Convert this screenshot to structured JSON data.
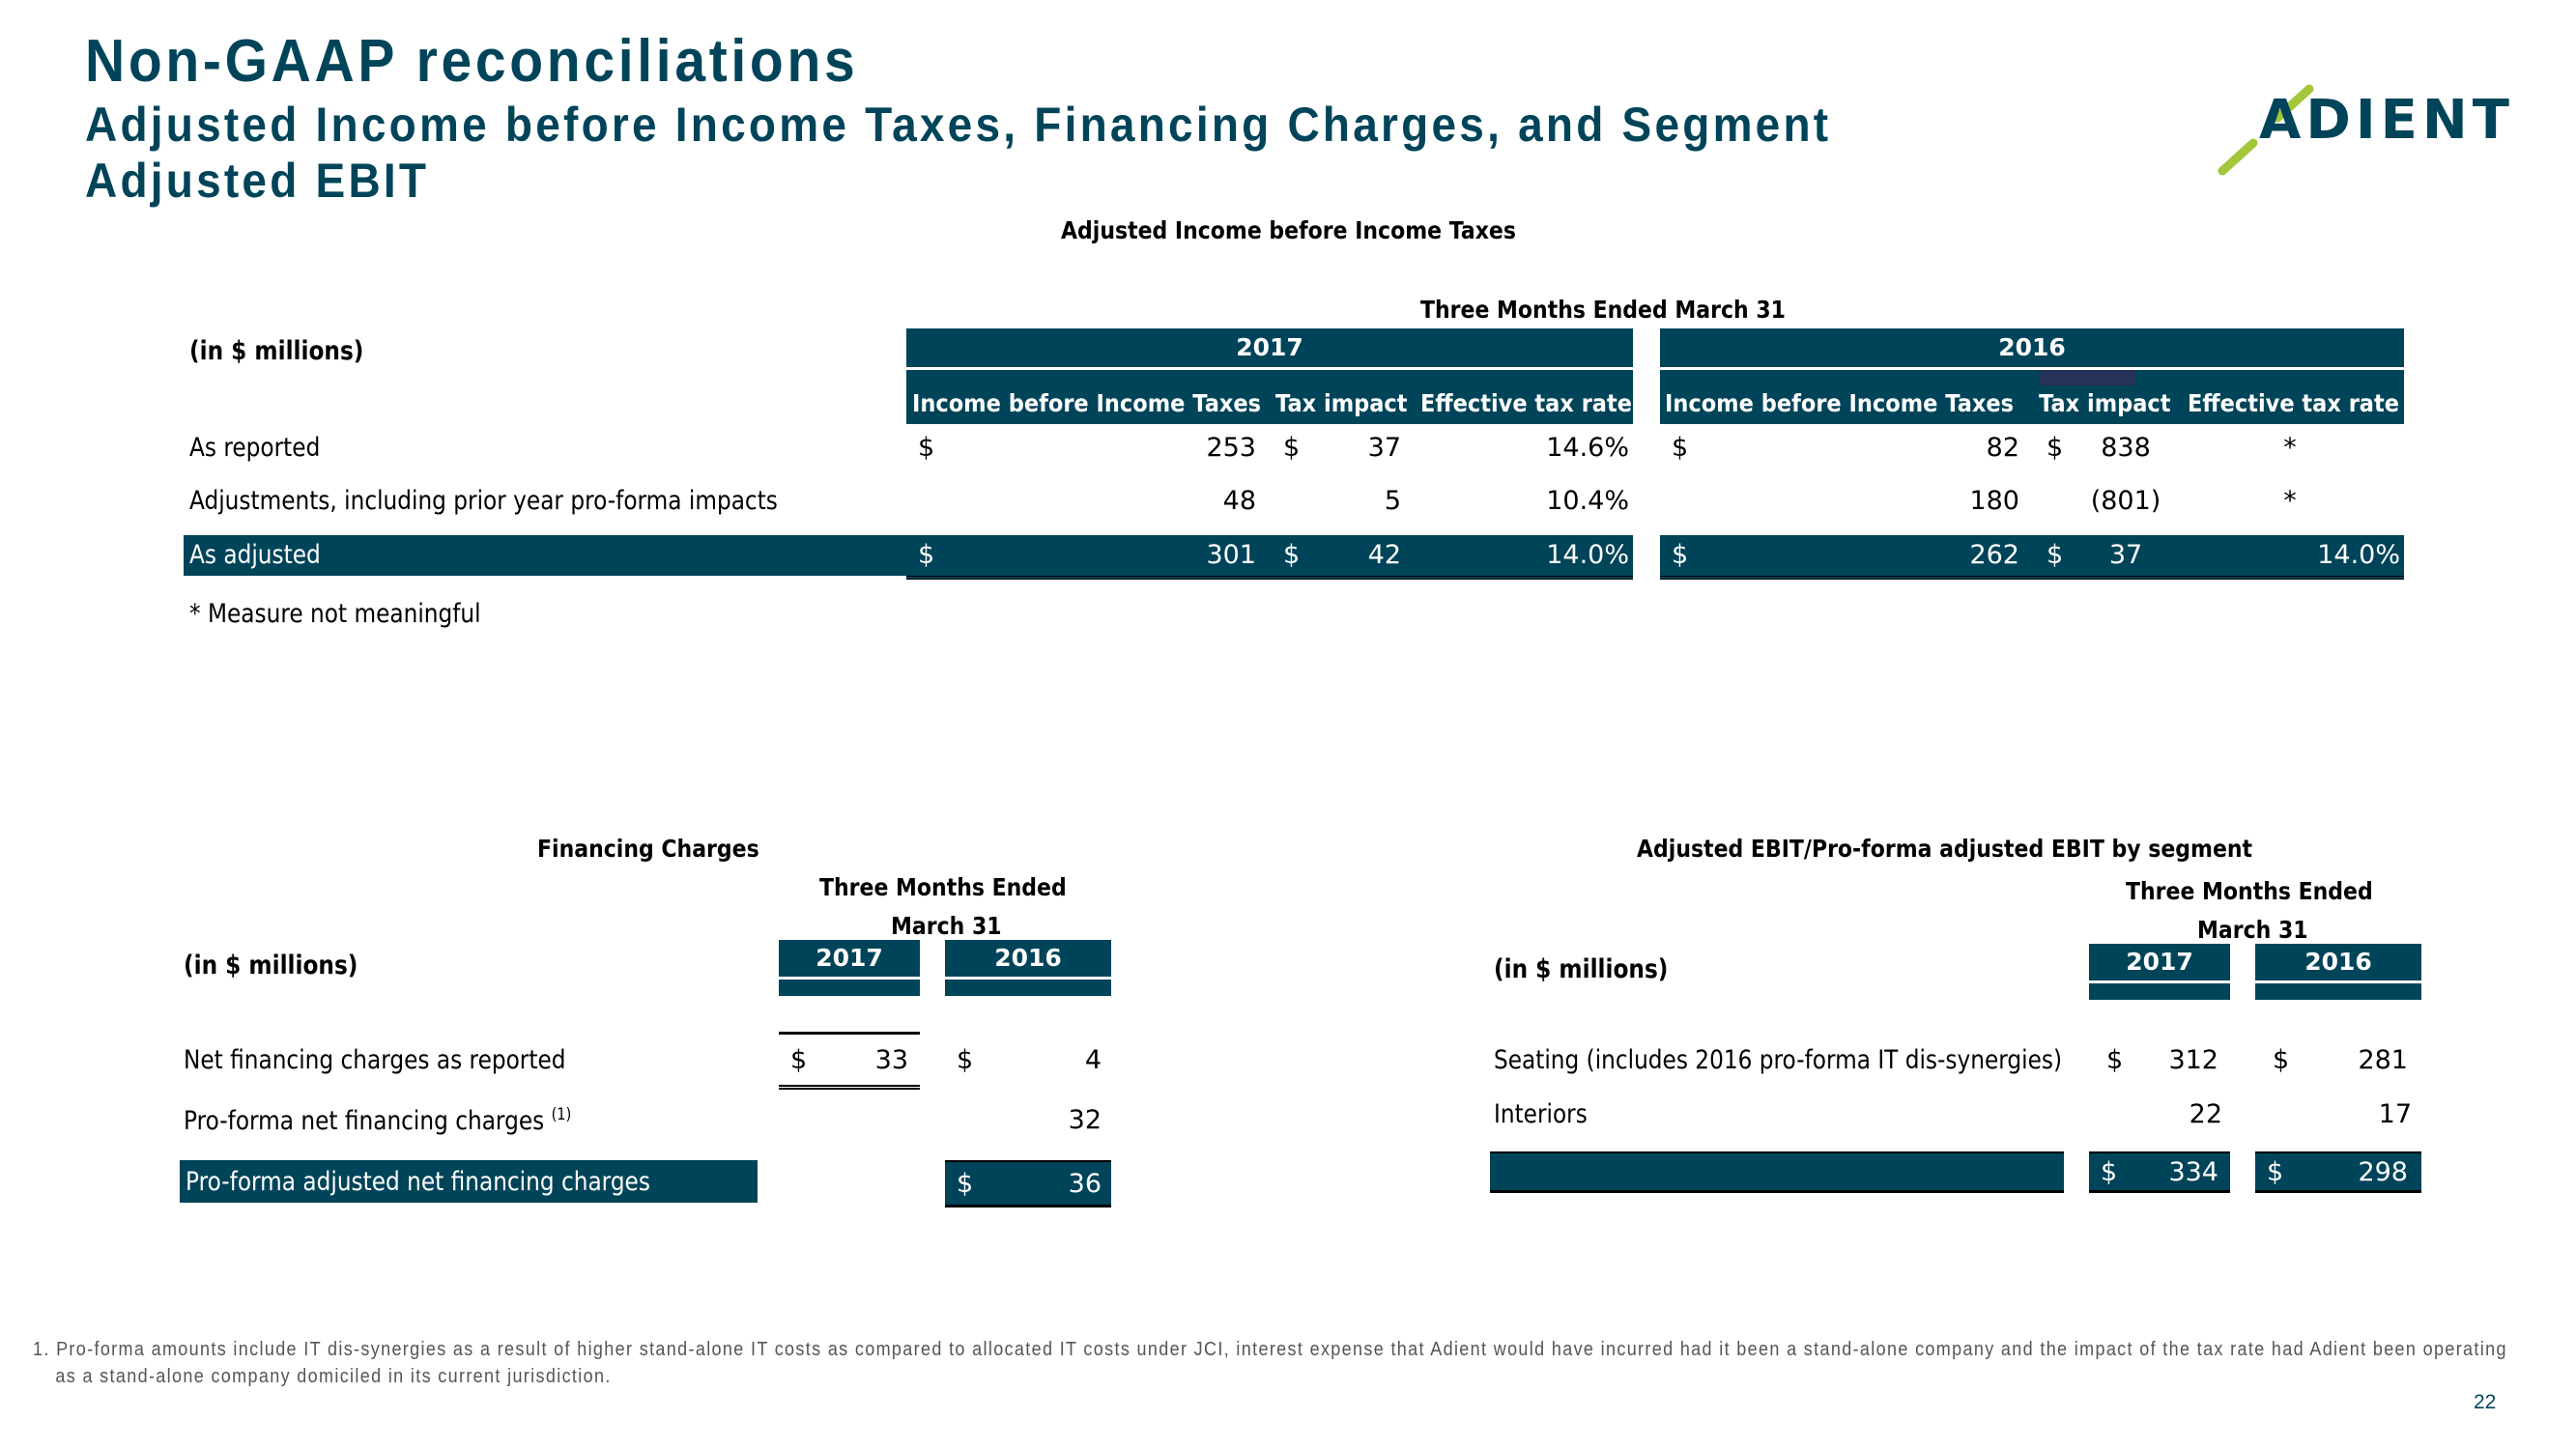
{
  "header": {
    "title": "Non-GAAP reconciliations",
    "subtitle": "Adjusted Income before Income Taxes, Financing Charges, and Segment Adjusted EBIT",
    "logo_text": "ADIENT",
    "logo_icon": "adient-slash-logo",
    "brand_color": "#004459",
    "accent_color": "#A4C639"
  },
  "income_table": {
    "title": "Adjusted Income before Income Taxes",
    "period": "Three Months Ended March 31",
    "units": "(in $ millions)",
    "years": [
      "2017",
      "2016"
    ],
    "columns": [
      "Income before Income Taxes",
      "Tax impact",
      "Effective tax rate"
    ],
    "rows": [
      {
        "label": "As reported",
        "y2017": {
          "income_cur": "$",
          "income": "253",
          "tax_cur": "$",
          "tax": "37",
          "rate": "14.6%"
        },
        "y2016": {
          "income_cur": "$",
          "income": "82",
          "tax_cur": "$",
          "tax": "838",
          "rate": "*"
        }
      },
      {
        "label": "Adjustments, including prior year pro-forma impacts",
        "y2017": {
          "income_cur": "",
          "income": "48",
          "tax_cur": "",
          "tax": "5",
          "rate": "10.4%"
        },
        "y2016": {
          "income_cur": "",
          "income": "180",
          "tax_cur": "",
          "tax": "(801)",
          "rate": "*"
        }
      },
      {
        "label": "As adjusted",
        "y2017": {
          "income_cur": "$",
          "income": "301",
          "tax_cur": "$",
          "tax": "42",
          "rate": "14.0%"
        },
        "y2016": {
          "income_cur": "$",
          "income": "262",
          "tax_cur": "$",
          "tax": "37",
          "rate": "14.0%"
        }
      }
    ],
    "note": "* Measure not meaningful"
  },
  "financing_table": {
    "title": "Financing Charges",
    "period_line1": "Three Months Ended",
    "period_line2": "March 31",
    "units": "(in $ millions)",
    "years": [
      "2017",
      "2016"
    ],
    "rows": [
      {
        "label": "Net financing charges as reported",
        "superscript": "",
        "cur2017": "$",
        "v2017": "33",
        "cur2016": "$",
        "v2016": "4"
      },
      {
        "label": "Pro-forma net financing charges",
        "superscript": "(1)",
        "cur2017": "",
        "v2017": "",
        "cur2016": "",
        "v2016": "32"
      },
      {
        "label": "Pro-forma adjusted net financing charges",
        "superscript": "",
        "cur2017": "",
        "v2017": "",
        "cur2016": "$",
        "v2016": "36"
      }
    ]
  },
  "segment_table": {
    "title": "Adjusted EBIT/Pro-forma adjusted EBIT by segment",
    "period_line1": "Three Months Ended",
    "period_line2": "March 31",
    "units": "(in $ millions)",
    "years": [
      "2017",
      "2016"
    ],
    "rows": [
      {
        "label": "Seating (includes 2016 pro-forma IT dis-synergies)",
        "cur2017": "$",
        "v2017": "312",
        "cur2016": "$",
        "v2016": "281"
      },
      {
        "label": "Interiors",
        "cur2017": "",
        "v2017": "22",
        "cur2016": "",
        "v2016": "17"
      },
      {
        "label": "",
        "cur2017": "$",
        "v2017": "334",
        "cur2016": "$",
        "v2016": "298"
      }
    ]
  },
  "footer": {
    "footnote": "1. Pro-forma amounts include IT dis-synergies as a result of higher stand-alone IT costs as compared to allocated IT costs under JCI, interest expense that Adient would have incurred had it been a stand-alone company and the impact of the tax rate had Adient been operating as a stand-alone company domiciled in its current jurisdiction.",
    "page_number": "22"
  }
}
